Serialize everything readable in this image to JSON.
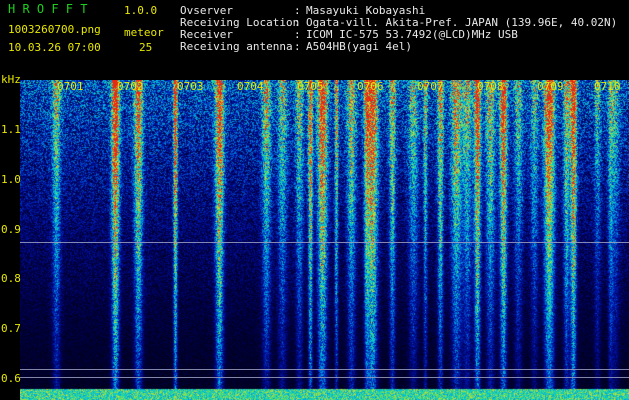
{
  "header": {
    "app_title": "H R O F F T",
    "version": "1.0.0",
    "filename": "1003260700.png",
    "datetime": "10.03.26 07:00",
    "meteor_label": "meteor",
    "meteor_count": "25"
  },
  "station_info": [
    {
      "label": "Ovserver",
      "sep": ":",
      "value": "Masayuki Kobayashi"
    },
    {
      "label": "Receiving Location",
      "sep": ":",
      "value": "Ogata-vill. Akita-Pref. JAPAN (139.96E, 40.02N)"
    },
    {
      "label": "Receiver",
      "sep": ":",
      "value": "ICOM IC-575 53.7492(@LCD)MHz USB"
    },
    {
      "label": "Receiving antenna",
      "sep": ":",
      "value": "A504HB(yagi 4el)"
    }
  ],
  "spectrogram": {
    "unit_label": "kHz",
    "y_ticks": [
      "1.1",
      "1.0",
      "0.9",
      "0.8",
      "0.7",
      "0.6"
    ],
    "time_ticks": [
      "0701",
      "0702",
      "0703",
      "0704",
      "0705",
      "0706",
      "0707",
      "0708",
      "0709",
      "0710"
    ],
    "colors": {
      "background": "#000000",
      "label": "#e8e800",
      "title": "#1ed01e",
      "text": "#e8e8e8"
    }
  }
}
